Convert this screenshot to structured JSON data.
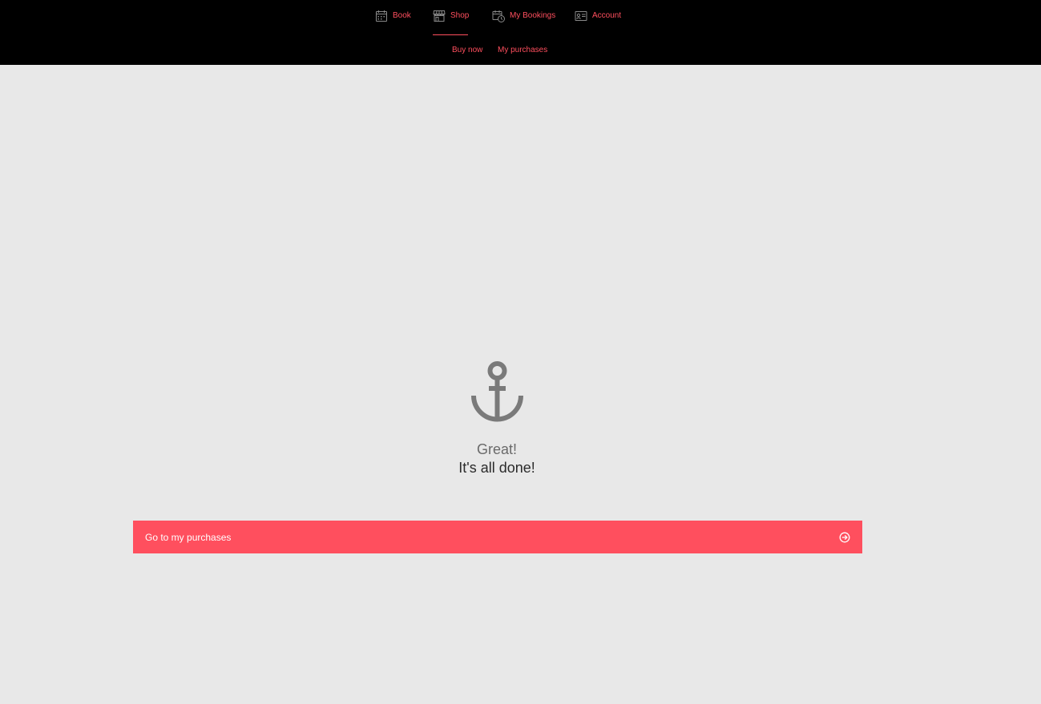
{
  "colors": {
    "accent": "#ff4f5e",
    "topbar_bg": "#000000",
    "page_bg": "#e8e8e8"
  },
  "nav": {
    "items": [
      {
        "label": "Book",
        "icon": "calendar-icon",
        "active": false
      },
      {
        "label": "Shop",
        "icon": "storefront-icon",
        "active": true
      },
      {
        "label": "My Bookings",
        "icon": "calendar-clock-icon",
        "active": false
      },
      {
        "label": "Account",
        "icon": "id-card-icon",
        "active": false
      }
    ]
  },
  "subnav": {
    "items": [
      {
        "label": "Buy now"
      },
      {
        "label": "My purchases"
      }
    ]
  },
  "confirmation": {
    "icon": "anchor-icon",
    "title": "Great!",
    "message": "It's all done!"
  },
  "cta": {
    "label": "Go to my purchases",
    "icon": "arrow-circle-right-icon"
  }
}
